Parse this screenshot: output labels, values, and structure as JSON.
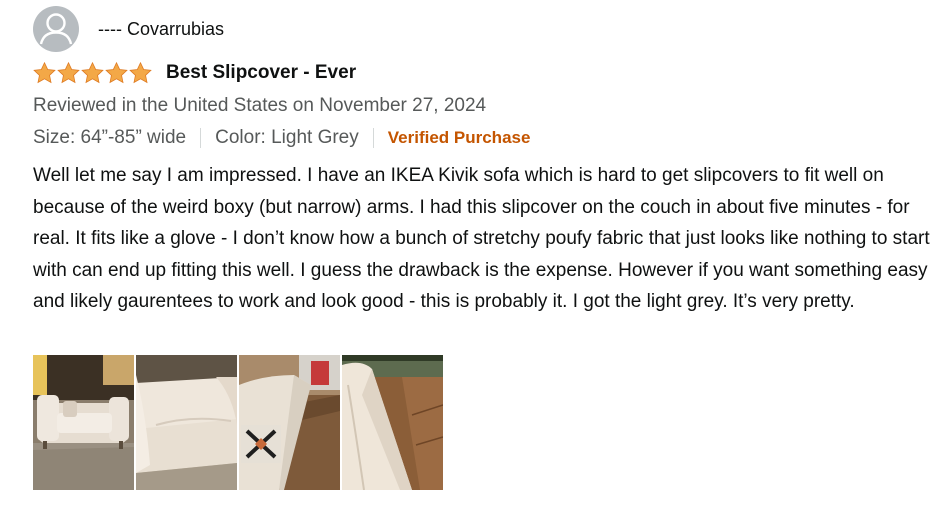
{
  "profile": {
    "name": "---- Covarrubias",
    "avatar_icon": "user-avatar-icon"
  },
  "rating": {
    "stars": 5,
    "max": 5,
    "star_color": "#f3a847"
  },
  "review": {
    "title": "Best Slipcover - Ever",
    "date_line": "Reviewed in the United States on November 27, 2024",
    "size": "Size: 64”-85” wide",
    "color": "Color: Light Grey",
    "verified": "Verified Purchase",
    "body": "Well let me say I am impressed. I have an IKEA Kivik sofa which is hard to get slipcovers to fit well on because of the weird boxy (but narrow) arms. I had this slipcover on the couch in about five minutes - for real. It fits like a glove - I don’t know how a bunch of stretchy poufy fabric that just looks like nothing to start with can end up fitting this well. I guess the drawback is the expense. However if you want something easy and likely gaurentees to work and look good - this is probably it. I got the light grey. It’s very pretty."
  },
  "colors": {
    "verified": "#c45500",
    "secondary_text": "#565959",
    "primary_text": "#0f1111"
  }
}
